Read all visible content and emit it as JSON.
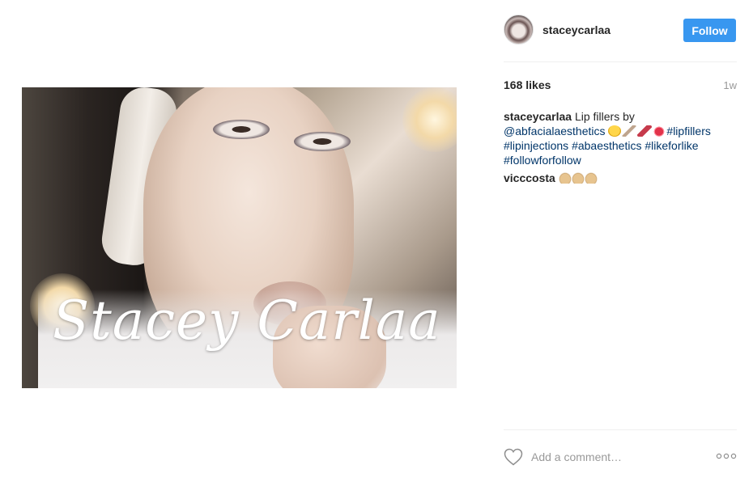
{
  "post": {
    "image_watermark": "Stacey Carlaa"
  },
  "header": {
    "username": "staceycarlaa",
    "follow_label": "Follow"
  },
  "meta": {
    "likes": "168 likes",
    "time_ago": "1w"
  },
  "comments": [
    {
      "author": "staceycarlaa",
      "text": "Lip fillers by",
      "mention": "@abfacialaesthetics",
      "emojis": [
        "heart-eyes-emoji",
        "syringe-emoji",
        "lipstick-emoji",
        "kiss-mark-emoji"
      ],
      "hashtags": [
        "#lipfillers",
        "#lipinjections",
        "#abaesthetics",
        "#likeforlike",
        "#followforfollow"
      ]
    },
    {
      "author": "vicccosta",
      "emojis": [
        "raised-hands-emoji",
        "raised-hands-emoji",
        "raised-hands-emoji"
      ]
    }
  ],
  "footer": {
    "comment_placeholder": "Add a comment…"
  },
  "colors": {
    "follow_button": "#3897f0",
    "hashtag": "#003569",
    "muted": "#999999"
  },
  "icons": [
    "heart-icon",
    "more-options-icon"
  ]
}
